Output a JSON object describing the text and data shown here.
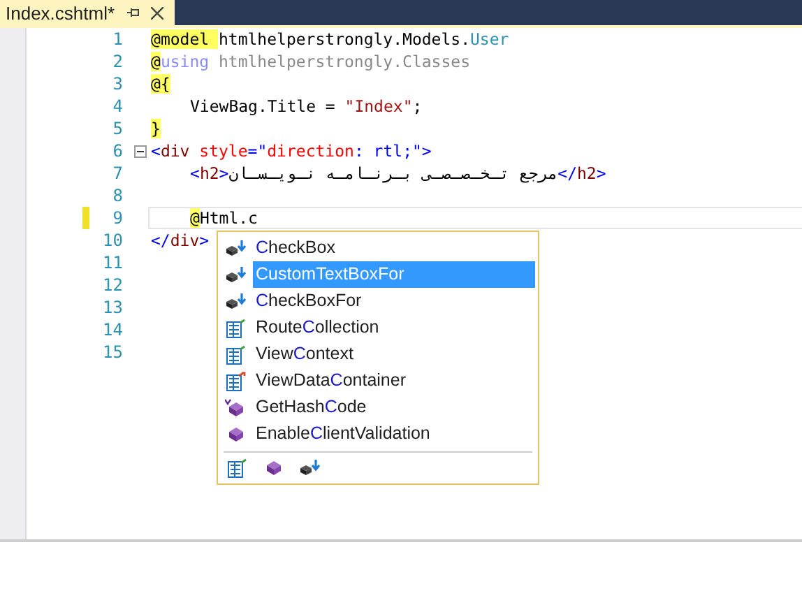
{
  "tab": {
    "title": "Index.cshtml*",
    "pinned": false
  },
  "lines": [
    {
      "number": "1",
      "tokens": [
        {
          "kind": "razor",
          "text": "@"
        },
        {
          "kind": "razor-kw",
          "text": "model "
        },
        {
          "kind": "plain",
          "text": "htmlhelperstrongly.Models."
        },
        {
          "kind": "type",
          "text": "User"
        }
      ]
    },
    {
      "number": "2",
      "tokens": [
        {
          "kind": "razor",
          "text": "@"
        },
        {
          "kind": "faded-kw",
          "text": "using"
        },
        {
          "kind": "faded",
          "text": " htmlhelperstrongly.Classes"
        }
      ]
    },
    {
      "number": "3",
      "tokens": [
        {
          "kind": "razor",
          "text": "@{"
        }
      ]
    },
    {
      "number": "4",
      "indented": true,
      "tokens": [
        {
          "kind": "plain",
          "text": "ViewBag.Title = "
        },
        {
          "kind": "string",
          "text": "\"Index\""
        },
        {
          "kind": "plain",
          "text": ";"
        }
      ]
    },
    {
      "number": "5",
      "tokens": [
        {
          "kind": "razor",
          "text": "}"
        }
      ]
    },
    {
      "number": "6",
      "collapsible": true,
      "tokens": [
        {
          "kind": "delim",
          "text": "<"
        },
        {
          "kind": "tag",
          "text": "div"
        },
        {
          "kind": "attr",
          "text": " style"
        },
        {
          "kind": "delim",
          "text": "=\""
        },
        {
          "kind": "attr",
          "text": "direction"
        },
        {
          "kind": "delim",
          "text": ": "
        },
        {
          "kind": "delim",
          "text": "rtl"
        },
        {
          "kind": "delim",
          "text": ";\">"
        }
      ]
    },
    {
      "number": "7",
      "indented": true,
      "tokens": [
        {
          "kind": "delim",
          "text": "<"
        },
        {
          "kind": "tag",
          "text": "h2"
        },
        {
          "kind": "delim",
          "text": ">"
        },
        {
          "kind": "plain",
          "text": "مرجع تـخـصـصـی بـرنـامـه نـویـسـان"
        },
        {
          "kind": "delim",
          "text": "</"
        },
        {
          "kind": "tag",
          "text": "h2"
        },
        {
          "kind": "delim",
          "text": ">"
        }
      ]
    },
    {
      "number": "8"
    },
    {
      "number": "9",
      "changed": true,
      "current": true,
      "indented": true,
      "tokens": [
        {
          "kind": "razor",
          "text": "@"
        },
        {
          "kind": "plain",
          "text": "Html.c"
        }
      ]
    },
    {
      "number": "10",
      "tokens": [
        {
          "kind": "delim",
          "text": "</"
        },
        {
          "kind": "tag",
          "text": "div"
        },
        {
          "kind": "delim",
          "text": ">"
        }
      ]
    },
    {
      "number": "11"
    },
    {
      "number": "12"
    },
    {
      "number": "13"
    },
    {
      "number": "14"
    },
    {
      "number": "15"
    }
  ],
  "completion": {
    "items": [
      {
        "kind": "extension",
        "match": "C",
        "after": "heckBox",
        "selected": false
      },
      {
        "kind": "extension",
        "match": "C",
        "after": "ustomTextBoxFor",
        "selected": true
      },
      {
        "kind": "extension",
        "match": "C",
        "after": "heckBoxFor",
        "selected": false
      },
      {
        "kind": "property",
        "before": "Route",
        "match": "C",
        "after": "ollection",
        "selected": false
      },
      {
        "kind": "property",
        "before": "View",
        "match": "C",
        "after": "ontext",
        "selected": false
      },
      {
        "kind": "property-alt",
        "before": "ViewData",
        "match": "C",
        "after": "ontainer",
        "selected": false
      },
      {
        "kind": "virtual-method",
        "before": "GetHash",
        "match": "C",
        "after": "ode",
        "selected": false
      },
      {
        "kind": "method",
        "before": "Enable",
        "match": "C",
        "after": "lientValidation",
        "selected": false
      }
    ],
    "filters": [
      {
        "kind": "property"
      },
      {
        "kind": "method"
      },
      {
        "kind": "extension"
      }
    ]
  }
}
